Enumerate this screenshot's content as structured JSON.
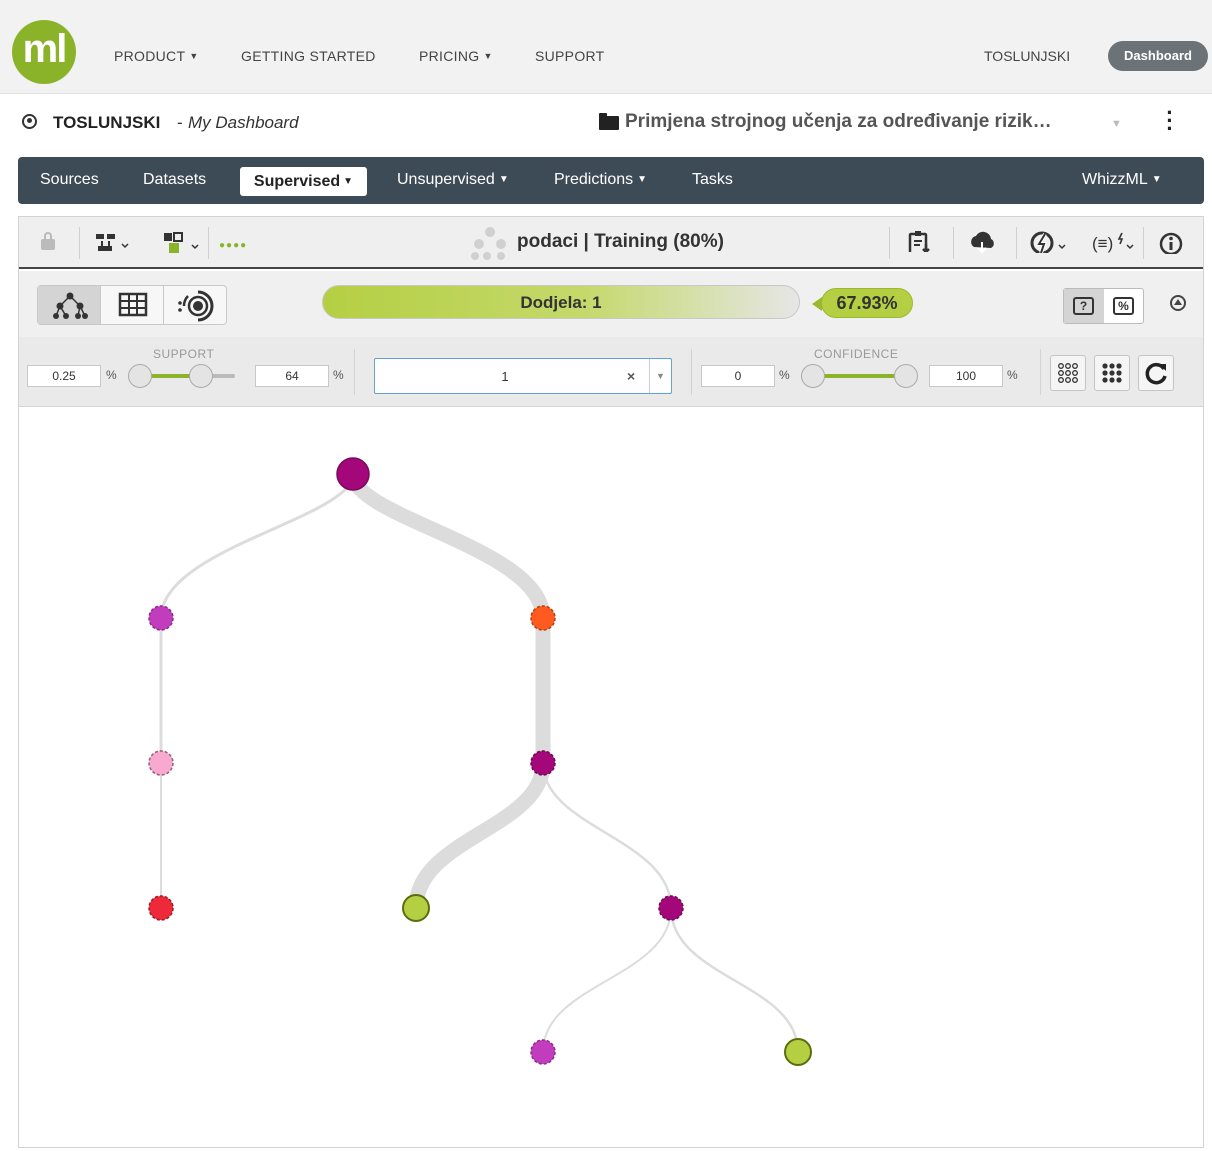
{
  "header": {
    "logo_text": "ml",
    "nav": [
      "PRODUCT",
      "GETTING STARTED",
      "PRICING",
      "SUPPORT"
    ],
    "user": "TOSLUNJSKI",
    "dashboard_button": "Dashboard"
  },
  "breadcrumb": {
    "user": "TOSLUNJSKI",
    "separator": "-",
    "dashboard": "My Dashboard",
    "project": "Primjena strojnog učenja za određivanje rizik…"
  },
  "resource_nav": {
    "items": [
      "Sources",
      "Datasets",
      "Supervised",
      "Unsupervised",
      "Predictions",
      "Tasks"
    ],
    "active": "Supervised",
    "right": "WhizzML"
  },
  "model": {
    "title": "podaci | Training (80%)",
    "prediction_label": "Dodjela: 1",
    "confidence": "67.93%"
  },
  "filters": {
    "support_label": "SUPPORT",
    "support_min": "0.25",
    "support_max": "64",
    "output_value": "1",
    "confidence_label": "CONFIDENCE",
    "confidence_min": "0",
    "confidence_max": "100",
    "percent_symbol": "%"
  },
  "colors": {
    "accent_green": "#8ab32a",
    "nav_bar": "#3d4b57",
    "node_purple": "#a4077a",
    "node_magenta": "#c13dbe",
    "node_orange": "#ff5a1f",
    "node_pink": "#f7a9cf",
    "node_red": "#ee2a3a",
    "node_leaf_green": "#b5cf43"
  },
  "tree": {
    "nodes": [
      {
        "id": "root",
        "color": "#a4077a"
      },
      {
        "id": "left",
        "color": "#c13dbe"
      },
      {
        "id": "right",
        "color": "#ff5a1f"
      },
      {
        "id": "left-2",
        "color": "#f7a9cf"
      },
      {
        "id": "right-2",
        "color": "#a4077a"
      },
      {
        "id": "left-leaf",
        "color": "#ee2a3a"
      },
      {
        "id": "right-2-leaf",
        "color": "#b5cf43"
      },
      {
        "id": "right-3",
        "color": "#a4077a"
      },
      {
        "id": "right-3-left",
        "color": "#c13dbe"
      },
      {
        "id": "right-3-right",
        "color": "#b5cf43"
      }
    ]
  }
}
